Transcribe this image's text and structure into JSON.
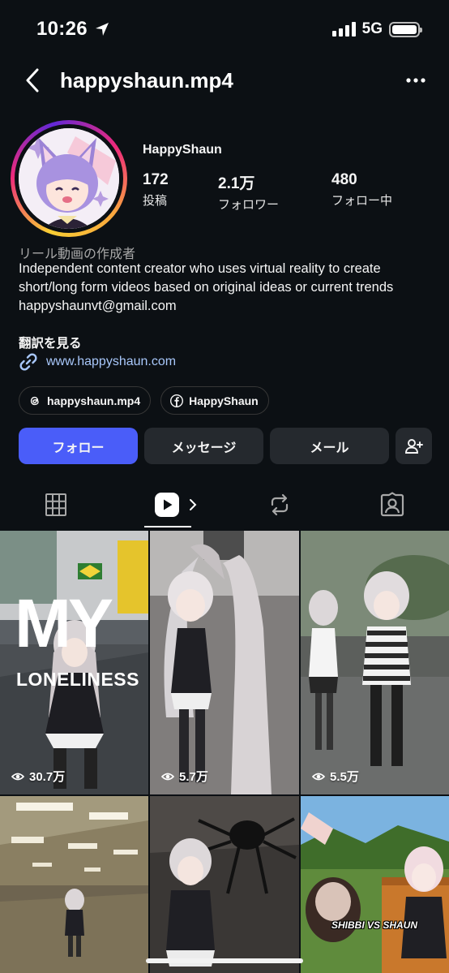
{
  "status_bar": {
    "time": "10:26",
    "network": "5G"
  },
  "header": {
    "username": "happyshaun.mp4"
  },
  "profile": {
    "display_name": "HappyShaun",
    "stats": [
      {
        "number": "172",
        "label": "投稿"
      },
      {
        "number": "2.1万",
        "label": "フォロワー"
      },
      {
        "number": "480",
        "label": "フォロー中"
      }
    ],
    "category": "リール動画の作成者",
    "bio": "Independent content creator who uses virtual reality to create short/long form videos based on original ideas or current trends",
    "email": "happyshaunvt@gmail.com",
    "translate_label": "翻訳を見る",
    "link": "www.happyshaun.com"
  },
  "chips": {
    "threads": "happyshaun.mp4",
    "facebook": "HappyShaun"
  },
  "actions": {
    "follow": "フォロー",
    "message": "メッセージ",
    "email": "メール"
  },
  "grid": {
    "items": [
      {
        "views": "30.7万",
        "overlay_title": "MY",
        "overlay_subtitle": "LONELINESS"
      },
      {
        "views": "5.7万"
      },
      {
        "views": "5.5万"
      },
      {},
      {},
      {
        "overlay_text": "SHIBBI VS SHAUN"
      }
    ]
  },
  "colors": {
    "background": "#0c1014",
    "primary_button": "#4a5df9",
    "secondary_button": "#25292e",
    "link": "#a8c7fa"
  }
}
